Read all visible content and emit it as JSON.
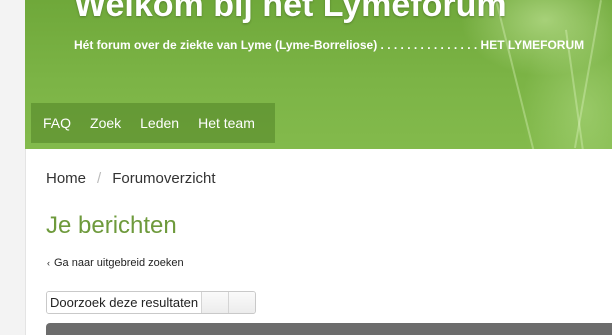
{
  "header": {
    "title": "Welkom bij het Lymeforum",
    "subtitle": "Hét forum over de ziekte van Lyme (Lyme-Borreliose) . . . . . . . . . . . . . . . HET LYMEFORUM"
  },
  "nav": {
    "items": [
      {
        "label": "FAQ"
      },
      {
        "label": "Zoek"
      },
      {
        "label": "Leden"
      },
      {
        "label": "Het team"
      }
    ]
  },
  "breadcrumb": {
    "home": "Home",
    "separator": "/",
    "current": "Forumoverzicht"
  },
  "page": {
    "title": "Je berichten",
    "advanced_search_link": "Ga naar uitgebreid zoeken",
    "advanced_search_icon": "chevron-left-icon"
  },
  "search": {
    "value": "Doorzoek deze resultaten"
  },
  "colors": {
    "header_green": "#7cb446",
    "title_green": "#6e9a3c",
    "bottom_bar": "#6c6c6c"
  }
}
